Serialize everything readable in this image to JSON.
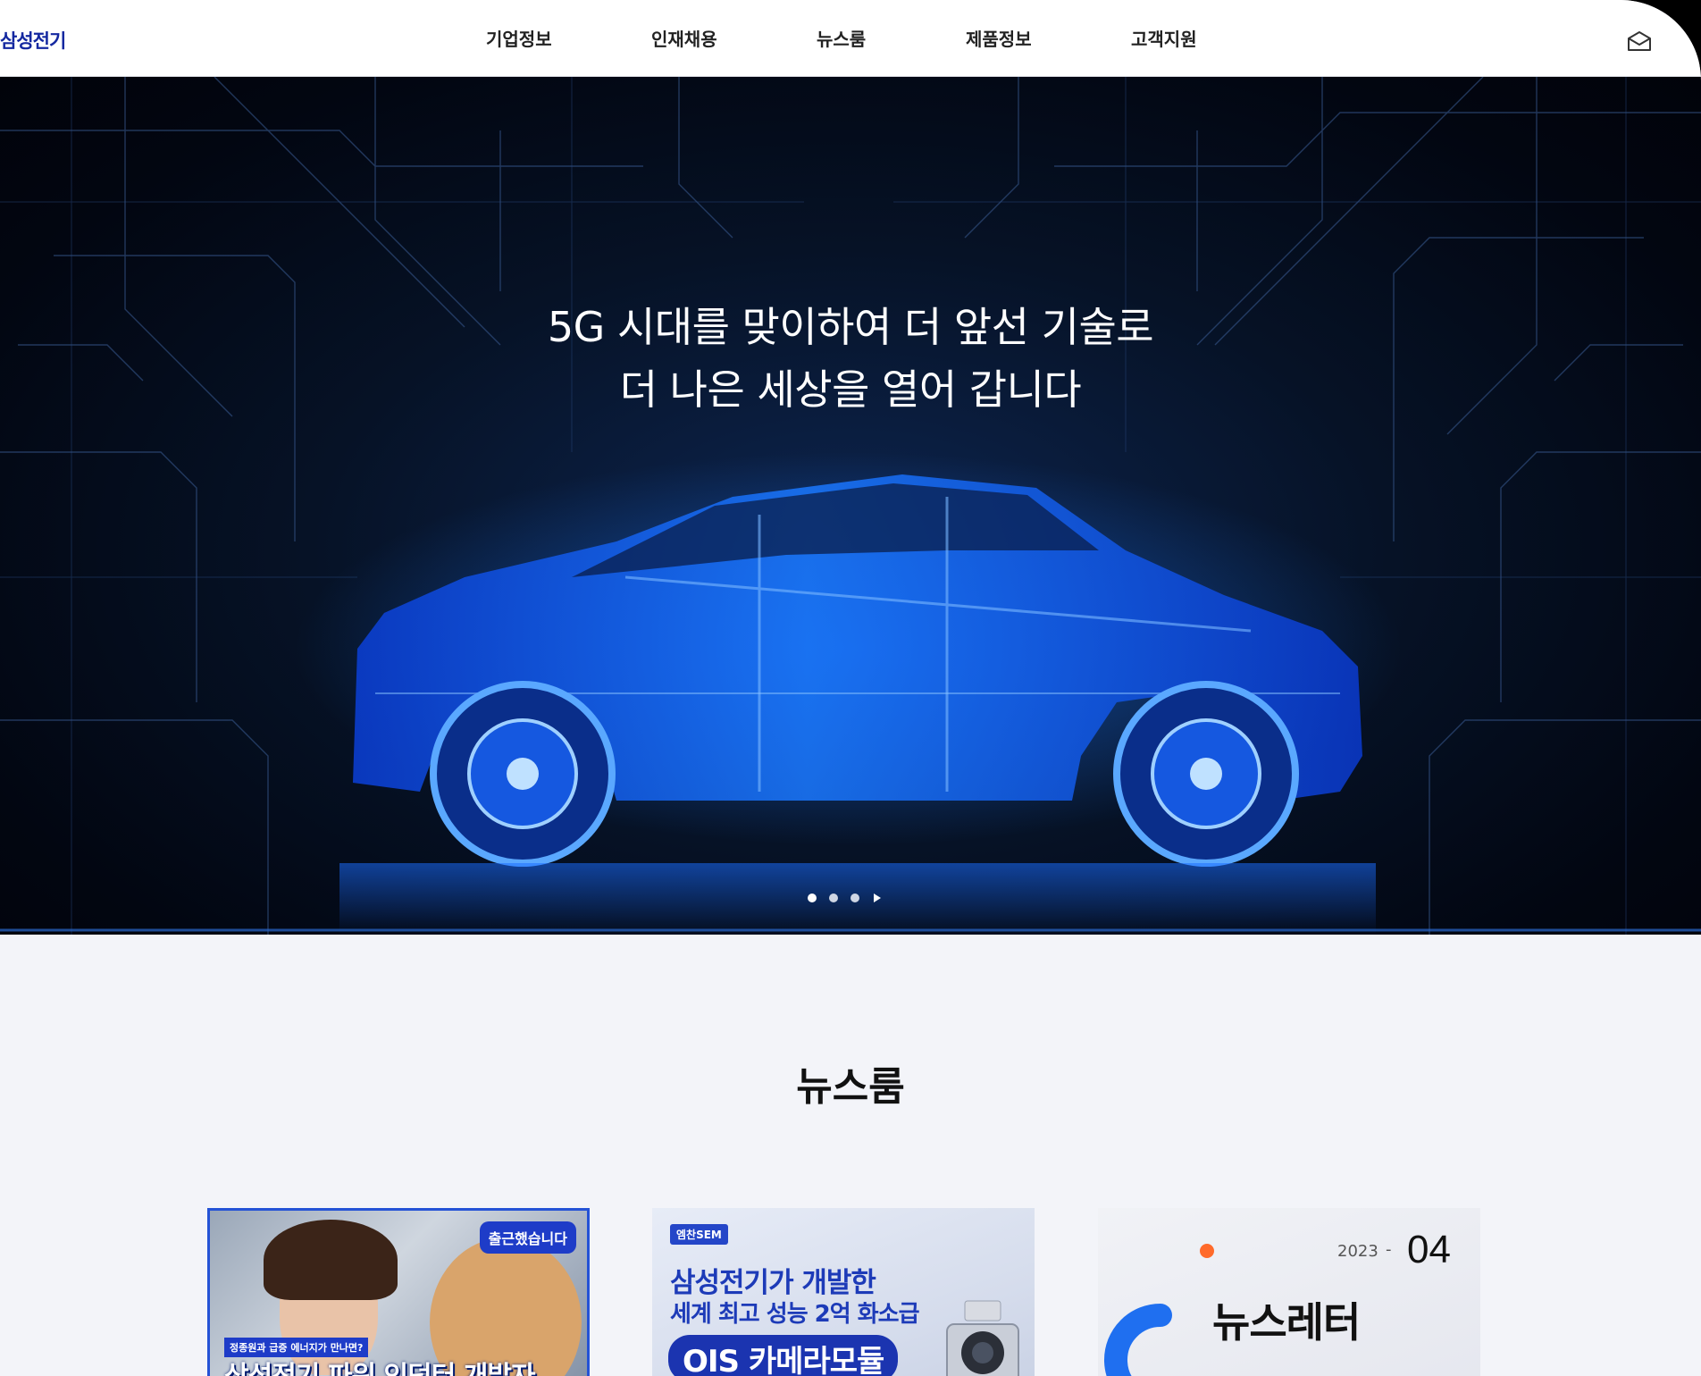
{
  "header": {
    "logo_text": "삼성전기",
    "nav": [
      "기업정보",
      "인재채용",
      "뉴스룸",
      "제품정보",
      "고객지원"
    ],
    "mail_icon": "mail-icon"
  },
  "hero": {
    "title_line1": "5G 시대를 맞이하여 더 앞선 기술로",
    "title_line2": "더 나은 세상을 열어 갑니다",
    "slide_count": 3,
    "active_slide": 1,
    "next_icon": "play-next-icon"
  },
  "newsroom": {
    "title": "뉴스룸",
    "cards": [
      {
        "badge": "출근했습니다",
        "subtitle": "정종원과 급증 에너지가 만나면?",
        "title": "삼성전기 파워 인덕터 개발자"
      },
      {
        "tag": "엠찬SEM",
        "line1": "삼성전기가 개발한",
        "line2": "세계 최고 성능 2억 화소급",
        "pill": "OIS 카메라모듈"
      },
      {
        "year": "2023",
        "dash": "-",
        "month": "04",
        "title": "뉴스레터"
      }
    ]
  },
  "colors": {
    "brand": "#1428a0",
    "hero_glow": "#1e7bff",
    "page_bg": "#f3f4f9"
  }
}
